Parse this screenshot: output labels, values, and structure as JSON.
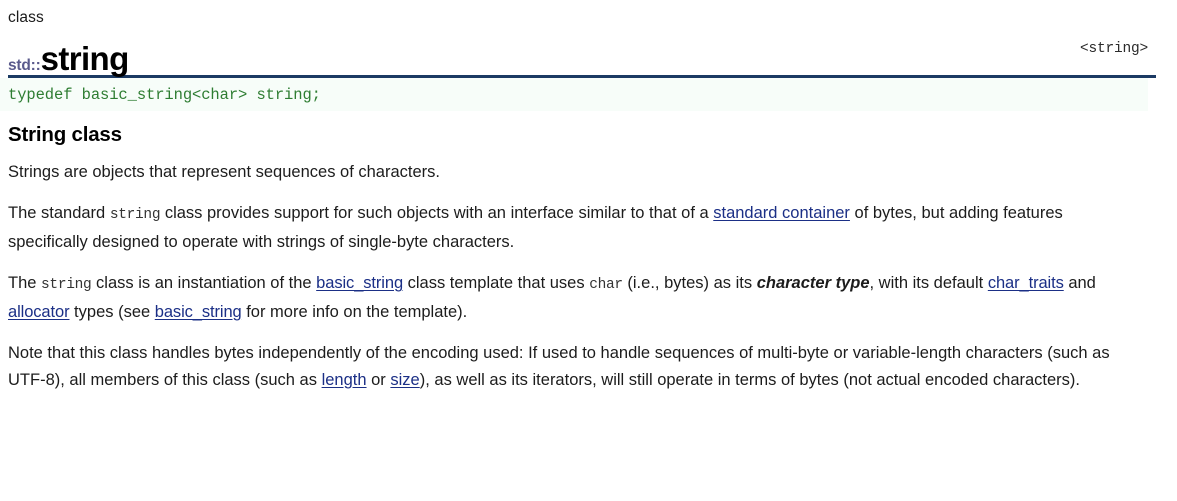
{
  "header": {
    "kind": "class",
    "namespace": "std::",
    "name": "string",
    "include": "<string>"
  },
  "code_block": {
    "typedef_line": "typedef basic_string<char> string;"
  },
  "section": {
    "title": "String class"
  },
  "paragraphs": {
    "p1": {
      "t1": "Strings are objects that represent sequences of characters."
    },
    "p2": {
      "t1": "The standard ",
      "code1": "string",
      "t2": " class provides support for such objects with an interface similar to that of a ",
      "link1": "standard container",
      "t3": " of bytes, but adding features specifically designed to operate with strings of single-byte characters."
    },
    "p3": {
      "t1": "The ",
      "code1": "string",
      "t2": " class is an instantiation of the ",
      "link1": "basic_string",
      "t3": " class template that uses ",
      "code2": "char",
      "t4": " (i.e., bytes) as its ",
      "bold1": "character type",
      "t5": ", with its default ",
      "link2": "char_traits",
      "t6": " and ",
      "link3": "allocator",
      "t7": " types (see ",
      "link4": "basic_string",
      "t8": " for more info on the template)."
    },
    "p4": {
      "t1": "Note that this class handles bytes independently of the encoding used: If used to handle sequences of multi-byte or variable-length characters (such as UTF-8), all members of this class (such as ",
      "link1": "length",
      "t2": " or ",
      "link2": "size",
      "t3": "), as well as its iterators, will still operate in terms of bytes (not actual encoded characters)."
    }
  },
  "colors": {
    "rule": "#1b3a63",
    "namespace": "#5a5a8c",
    "code_green": "#2e7d32",
    "link": "#1b2f86",
    "code_bg": "#f7fdf9"
  }
}
